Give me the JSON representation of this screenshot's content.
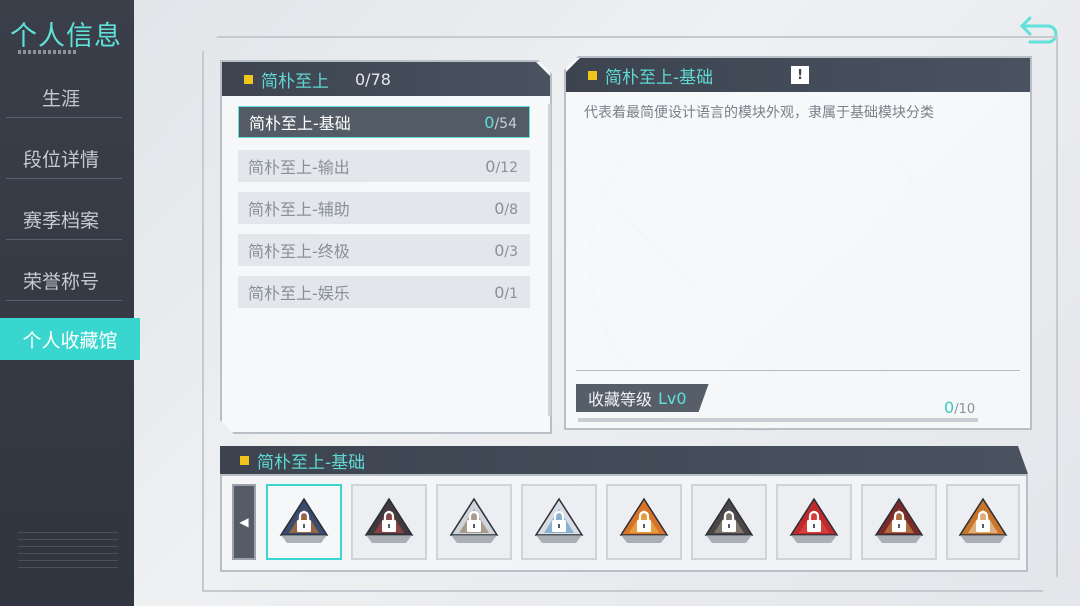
{
  "sidebar": {
    "title": "个人信息",
    "items": [
      {
        "label": "生涯"
      },
      {
        "label": "段位详情"
      },
      {
        "label": "赛季档案"
      },
      {
        "label": "荣誉称号"
      },
      {
        "label": "个人收藏馆"
      }
    ],
    "active_index": 4
  },
  "categories_panel": {
    "title": "简朴至上",
    "count": "0/78",
    "items": [
      {
        "label": "简朴至上-基础",
        "current": "0",
        "total": "/54"
      },
      {
        "label": "简朴至上-输出",
        "current": "0",
        "total": "/12"
      },
      {
        "label": "简朴至上-辅助",
        "current": "0",
        "total": "/8"
      },
      {
        "label": "简朴至上-终极",
        "current": "0",
        "total": "/3"
      },
      {
        "label": "简朴至上-娱乐",
        "current": "0",
        "total": "/1"
      }
    ]
  },
  "detail_panel": {
    "title": "简朴至上-基础",
    "info_icon": "!",
    "description": "代表着最简便设计语言的模块外观，隶属于基础模块分类",
    "level_label": "收藏等级",
    "level_value": "Lv0",
    "progress_current": "0",
    "progress_total": "/10",
    "progress_fraction": 0
  },
  "items_strip": {
    "title": "简朴至上-基础",
    "prev_icon": "◀",
    "next_icon": "▶",
    "items": [
      {
        "name": "module-item",
        "color": "#3a4c6e",
        "accent": "#e07a2a",
        "locked": true
      },
      {
        "name": "module-item",
        "color": "#3e3a3e",
        "accent": "#c94a4a",
        "locked": true
      },
      {
        "name": "module-item",
        "color": "#cfd4da",
        "accent": "#8a6a4a",
        "locked": true
      },
      {
        "name": "module-item",
        "color": "#d8dde3",
        "accent": "#4a8ac4",
        "locked": true
      },
      {
        "name": "module-item",
        "color": "#d8742a",
        "accent": "#f0c050",
        "locked": true
      },
      {
        "name": "module-item",
        "color": "#4a4546",
        "accent": "#a89a8a",
        "locked": true
      },
      {
        "name": "module-item",
        "color": "#c02a2a",
        "accent": "#e05050",
        "locked": true
      },
      {
        "name": "module-item",
        "color": "#7a2a2a",
        "accent": "#d8a050",
        "locked": true
      },
      {
        "name": "module-item",
        "color": "#c8742a",
        "accent": "#f0e0c0",
        "locked": true
      }
    ]
  },
  "colors": {
    "accent": "#39d6cf",
    "panel_header": "#3d4450",
    "sidebar": "#333842",
    "marker": "#f0c419"
  }
}
